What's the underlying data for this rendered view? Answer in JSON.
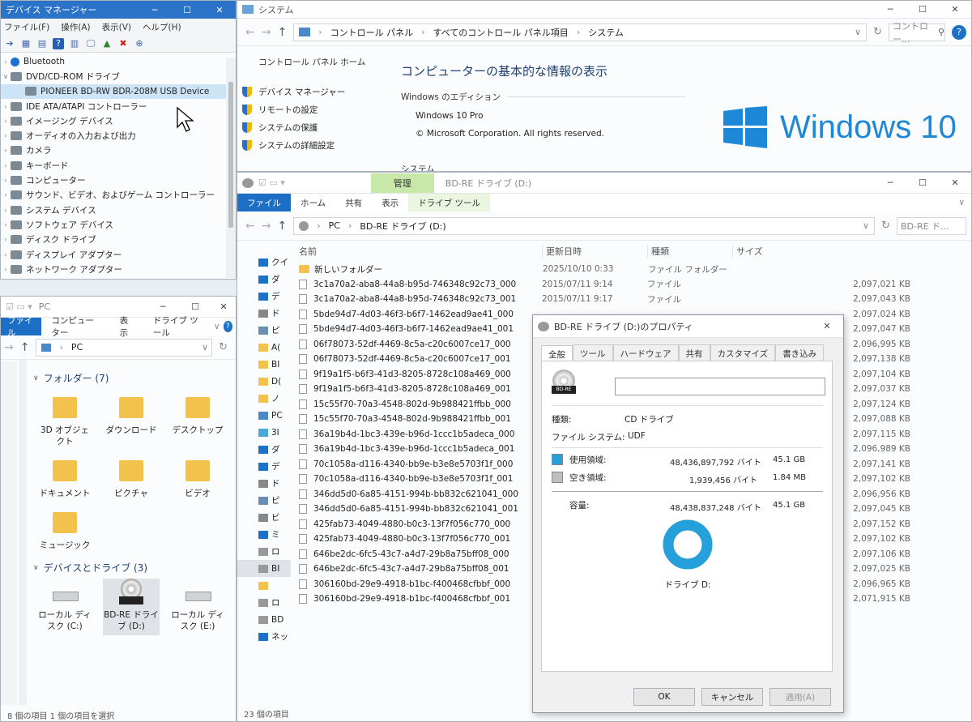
{
  "device_manager": {
    "title": "デバイス マネージャー",
    "menu": [
      "ファイル(F)",
      "操作(A)",
      "表示(V)",
      "ヘルプ(H)"
    ],
    "tree": [
      {
        "label": "Bluetooth",
        "expander": "›"
      },
      {
        "label": "DVD/CD-ROM ドライブ",
        "expander": "∨"
      },
      {
        "label": "PIONEER BD-RW   BDR-208M USB Device",
        "expander": "",
        "child": true,
        "selected": true
      },
      {
        "label": "IDE ATA/ATAPI コントローラー",
        "expander": "›"
      },
      {
        "label": "イメージング デバイス",
        "expander": "›"
      },
      {
        "label": "オーディオの入力および出力",
        "expander": "›"
      },
      {
        "label": "カメラ",
        "expander": "›"
      },
      {
        "label": "キーボード",
        "expander": "›"
      },
      {
        "label": "コンピューター",
        "expander": "›"
      },
      {
        "label": "サウンド、ビデオ、およびゲーム コントローラー",
        "expander": "›"
      },
      {
        "label": "システム デバイス",
        "expander": "›"
      },
      {
        "label": "ソフトウェア デバイス",
        "expander": "›"
      },
      {
        "label": "ディスク ドライブ",
        "expander": "›"
      },
      {
        "label": "ディスプレイ アダプター",
        "expander": "›"
      },
      {
        "label": "ネットワーク アダプター",
        "expander": "›"
      }
    ]
  },
  "system": {
    "title": "システム",
    "breadcrumb": [
      "コントロール パネル",
      "すべてのコントロール パネル項目",
      "システム"
    ],
    "search_placeholder": "コントロー...",
    "side_home": "コントロール パネル ホーム",
    "side_links": [
      "デバイス マネージャー",
      "リモートの設定",
      "システムの保護",
      "システムの詳細設定"
    ],
    "heading": "コンピューターの基本的な情報の表示",
    "edition_section": "Windows のエディション",
    "edition": "Windows 10 Pro",
    "copyright": "© Microsoft Corporation. All rights reserved.",
    "system_section": "システム",
    "logo_text": "Windows 10"
  },
  "explorer_d": {
    "title": "BD-RE ドライブ (D:)",
    "manage_tab": "管理",
    "tabs": [
      "ファイル",
      "ホーム",
      "共有",
      "表示"
    ],
    "drive_tools": "ドライブ ツール",
    "breadcrumb": [
      "PC",
      "BD-RE ドライブ (D:)"
    ],
    "search_placeholder": "BD-RE ド...",
    "columns": {
      "name": "名前",
      "date": "更新日時",
      "type": "種類",
      "size": "サイズ"
    },
    "nav": [
      "クイ",
      "ダ",
      "デ",
      "ド",
      "ピ",
      "A(",
      "BI",
      "D(",
      "ノ",
      "PC",
      "3I",
      "ダ",
      "デ",
      "ド",
      "ピ",
      "ビ",
      "ミ",
      "ロ",
      "BI",
      "",
      "ロ",
      "BD",
      "ネッ"
    ],
    "status": "23 個の項目",
    "files": [
      {
        "name": "新しいフォルダー",
        "date": "2025/10/10 0:33",
        "type": "ファイル フォルダー",
        "size": "",
        "folder": true
      },
      {
        "name": "3c1a70a2-aba8-44a8-b95d-746348c92c73_000",
        "date": "2015/07/11 9:14",
        "type": "ファイル",
        "size": "2,097,021 KB"
      },
      {
        "name": "3c1a70a2-aba8-44a8-b95d-746348c92c73_001",
        "date": "2015/07/11 9:17",
        "type": "ファイル",
        "size": "2,097,043 KB"
      },
      {
        "name": "5bde94d7-4d03-46f3-b6f7-1462ead9ae41_000",
        "date": "",
        "type": "",
        "size": "2,097,024 KB"
      },
      {
        "name": "5bde94d7-4d03-46f3-b6f7-1462ead9ae41_001",
        "date": "",
        "type": "",
        "size": "2,097,047 KB"
      },
      {
        "name": "06f78073-52df-4469-8c5a-c20c6007ce17_000",
        "date": "",
        "type": "",
        "size": "2,096,995 KB"
      },
      {
        "name": "06f78073-52df-4469-8c5a-c20c6007ce17_001",
        "date": "",
        "type": "",
        "size": "2,097,138 KB"
      },
      {
        "name": "9f19a1f5-b6f3-41d3-8205-8728c108a469_000",
        "date": "",
        "type": "",
        "size": "2,097,104 KB"
      },
      {
        "name": "9f19a1f5-b6f3-41d3-8205-8728c108a469_001",
        "date": "",
        "type": "",
        "size": "2,097,037 KB"
      },
      {
        "name": "15c55f70-70a3-4548-802d-9b988421ffbb_000",
        "date": "",
        "type": "",
        "size": "2,097,124 KB"
      },
      {
        "name": "15c55f70-70a3-4548-802d-9b988421ffbb_001",
        "date": "",
        "type": "",
        "size": "2,097,088 KB"
      },
      {
        "name": "36a19b4d-1bc3-439e-b96d-1ccc1b5adeca_000",
        "date": "",
        "type": "",
        "size": "2,097,115 KB"
      },
      {
        "name": "36a19b4d-1bc3-439e-b96d-1ccc1b5adeca_001",
        "date": "",
        "type": "",
        "size": "2,096,989 KB"
      },
      {
        "name": "70c1058a-d116-4340-bb9e-b3e8e5703f1f_000",
        "date": "",
        "type": "",
        "size": "2,097,141 KB"
      },
      {
        "name": "70c1058a-d116-4340-bb9e-b3e8e5703f1f_001",
        "date": "",
        "type": "",
        "size": "2,097,102 KB"
      },
      {
        "name": "346dd5d0-6a85-4151-994b-bb832c621041_000",
        "date": "",
        "type": "",
        "size": "2,096,956 KB"
      },
      {
        "name": "346dd5d0-6a85-4151-994b-bb832c621041_001",
        "date": "",
        "type": "",
        "size": "2,097,045 KB"
      },
      {
        "name": "425fab73-4049-4880-b0c3-13f7f056c770_000",
        "date": "",
        "type": "",
        "size": "2,097,152 KB"
      },
      {
        "name": "425fab73-4049-4880-b0c3-13f7f056c770_001",
        "date": "",
        "type": "",
        "size": "2,097,102 KB"
      },
      {
        "name": "646be2dc-6fc5-43c7-a4d7-29b8a75bff08_000",
        "date": "",
        "type": "",
        "size": "2,097,106 KB"
      },
      {
        "name": "646be2dc-6fc5-43c7-a4d7-29b8a75bff08_001",
        "date": "",
        "type": "",
        "size": "2,097,025 KB"
      },
      {
        "name": "306160bd-29e9-4918-b1bc-f400468cfbbf_000",
        "date": "",
        "type": "",
        "size": "2,096,965 KB"
      },
      {
        "name": "306160bd-29e9-4918-b1bc-f400468cfbbf_001",
        "date": "",
        "type": "",
        "size": "2,071,915 KB"
      }
    ]
  },
  "explorer_pc": {
    "title": "PC",
    "tabs": [
      "ファイル",
      "コンピューター",
      "表示",
      "ドライブ ツール"
    ],
    "breadcrumb": "PC",
    "folders_header": "フォルダー (7)",
    "folders": [
      {
        "label": "3D オブジェクト",
        "icon": "3d-objects-folder"
      },
      {
        "label": "ダウンロード",
        "icon": "downloads-folder"
      },
      {
        "label": "デスクトップ",
        "icon": "desktop-folder"
      },
      {
        "label": "ドキュメント",
        "icon": "documents-folder"
      },
      {
        "label": "ピクチャ",
        "icon": "pictures-folder"
      },
      {
        "label": "ビデオ",
        "icon": "videos-folder"
      },
      {
        "label": "ミュージック",
        "icon": "music-folder"
      }
    ],
    "devices_header": "デバイスとドライブ (3)",
    "devices": [
      {
        "label": "ローカル ディスク (C:)",
        "icon": "local-disk"
      },
      {
        "label": "BD-RE ドライブ (D:)",
        "icon": "bd-re-drive"
      },
      {
        "label": "ローカル ディスク (E:)",
        "icon": "local-disk"
      }
    ],
    "status": "8 個の項目   1 個の項目を選択"
  },
  "properties": {
    "title": "BD-RE ドライブ (D:)のプロパティ",
    "tabs": [
      "全般",
      "ツール",
      "ハードウェア",
      "共有",
      "カスタマイズ",
      "書き込み"
    ],
    "drive_badge": "BD-RE",
    "type_label": "種類:",
    "type_value": "CD ドライブ",
    "fs_label": "ファイル システム:",
    "fs_value": "UDF",
    "used_label": "使用領域:",
    "used_bytes": "48,436,897,792 バイト",
    "used_size": "45.1 GB",
    "free_label": "空き領域:",
    "free_bytes": "1,939,456 バイト",
    "free_size": "1.84 MB",
    "capacity_label": "容量:",
    "capacity_bytes": "48,438,837,248 バイト",
    "capacity_size": "45.1 GB",
    "drive_label": "ドライブ D:",
    "used_fraction": 0.99996,
    "used_color": "#26a0da",
    "free_color": "#bfbfbf",
    "ok": "OK",
    "cancel": "キャンセル",
    "apply": "適用(A)"
  }
}
